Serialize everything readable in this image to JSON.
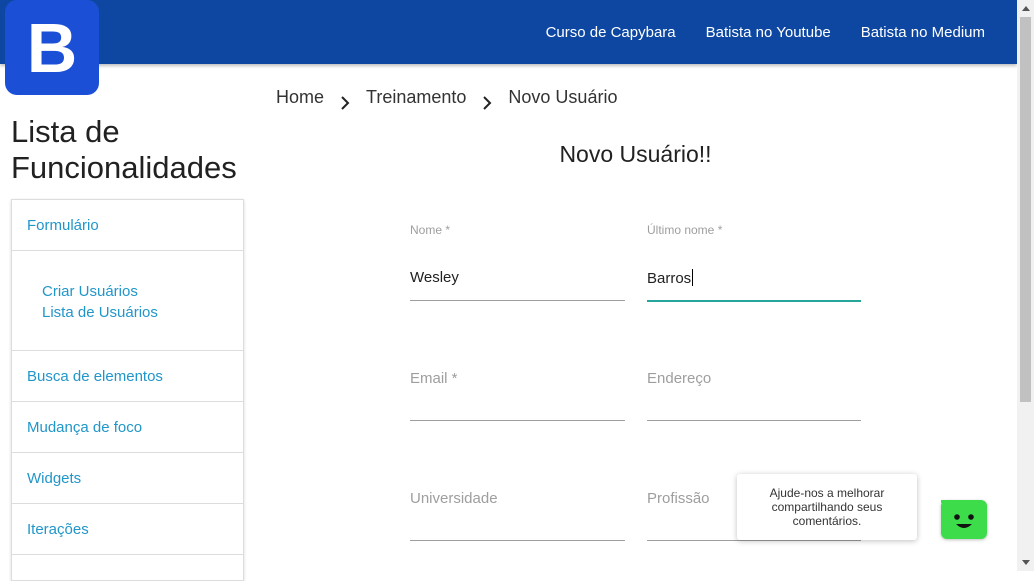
{
  "logo": {
    "letter": "B"
  },
  "topnav": {
    "items": [
      {
        "label": "Curso de Capybara"
      },
      {
        "label": "Batista no Youtube"
      },
      {
        "label": "Batista no Medium"
      }
    ]
  },
  "breadcrumb": {
    "items": [
      "Home",
      "Treinamento",
      "Novo Usuário"
    ]
  },
  "sidebar": {
    "title": "Lista de Funcionalidades",
    "items": [
      {
        "label": "Formulário"
      },
      {
        "label": "Criar Usuários"
      },
      {
        "label": "Lista de Usuários"
      },
      {
        "label": "Busca de elementos"
      },
      {
        "label": "Mudança de foco"
      },
      {
        "label": "Widgets"
      },
      {
        "label": "Iterações"
      }
    ]
  },
  "form": {
    "title": "Novo Usuário!!",
    "fields": {
      "nome": {
        "label": "Nome *",
        "value": "Wesley"
      },
      "ultimo_nome": {
        "label": "Último nome *",
        "value": "Barros"
      },
      "email": {
        "label": "Email *",
        "value": ""
      },
      "endereco": {
        "label": "Endereço",
        "value": ""
      },
      "universidade": {
        "label": "Universidade",
        "value": ""
      },
      "profissao": {
        "label": "Profissão",
        "value": ""
      }
    }
  },
  "feedback": {
    "text": "Ajude-nos a melhorar compartilhando seus comentários."
  },
  "colors": {
    "header": "#0d47a1",
    "logo": "#1a4fd6",
    "link": "#2196c9",
    "active_underline": "#26a69a",
    "feedback_button": "#3ddc4a"
  }
}
